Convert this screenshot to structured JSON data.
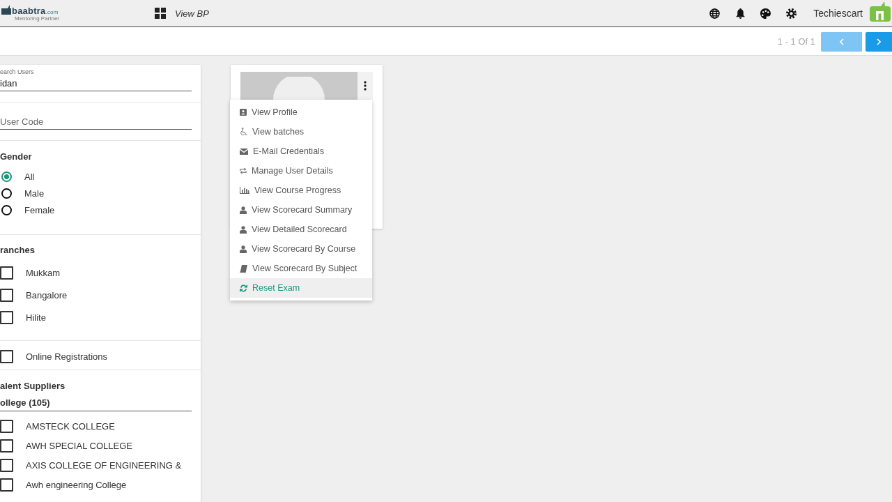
{
  "navbar": {
    "logo": {
      "name": "baabtra",
      "suffix": ".com",
      "tagline": "Mentoring Partner"
    },
    "page_title": "View BP",
    "user_name": "Techiescart"
  },
  "pagination": {
    "summary": "1 - 1 Of 1",
    "prev": {
      "disabled": true
    },
    "next": {
      "disabled": false
    }
  },
  "filters": {
    "search": {
      "label": "earch Users",
      "value": "idan"
    },
    "user_code": {
      "placeholder": "User Code"
    },
    "gender": {
      "title": "Gender",
      "options": [
        {
          "label": "All",
          "selected": true
        },
        {
          "label": "Male",
          "selected": false
        },
        {
          "label": "Female",
          "selected": false
        }
      ]
    },
    "branches": {
      "title": "ranches",
      "options": [
        {
          "label": "Mukkam",
          "checked": false
        },
        {
          "label": "Bangalore",
          "checked": false
        },
        {
          "label": "Hilite",
          "checked": false
        }
      ]
    },
    "online_registrations": {
      "label": "Online Registrations",
      "checked": false
    },
    "talent_suppliers": {
      "title": "alent Suppliers",
      "subtitle": "ollege (105)",
      "options": [
        {
          "label": "AMSTECK COLLEGE",
          "checked": false
        },
        {
          "label": "AWH SPECIAL COLLEGE",
          "checked": false
        },
        {
          "label": "AXIS COLLEGE OF ENGINEERING &",
          "checked": false
        },
        {
          "label": "Awh engineering College",
          "checked": false
        }
      ]
    }
  },
  "user_card": {
    "menu": {
      "items": [
        {
          "label": "View Profile",
          "selected": false
        },
        {
          "label": "View batches",
          "selected": false
        },
        {
          "label": "E-Mail Credentials",
          "selected": false
        },
        {
          "label": "Manage User Details",
          "selected": false
        },
        {
          "label": "View Course Progress",
          "selected": false
        },
        {
          "label": "View Scorecard Summary",
          "selected": false
        },
        {
          "label": "View Detailed Scorecard",
          "selected": false
        },
        {
          "label": "View Scorecard By Course",
          "selected": false
        },
        {
          "label": "View Scorecard By Subject",
          "selected": false
        },
        {
          "label": "Reset Exam",
          "selected": true
        }
      ]
    }
  }
}
